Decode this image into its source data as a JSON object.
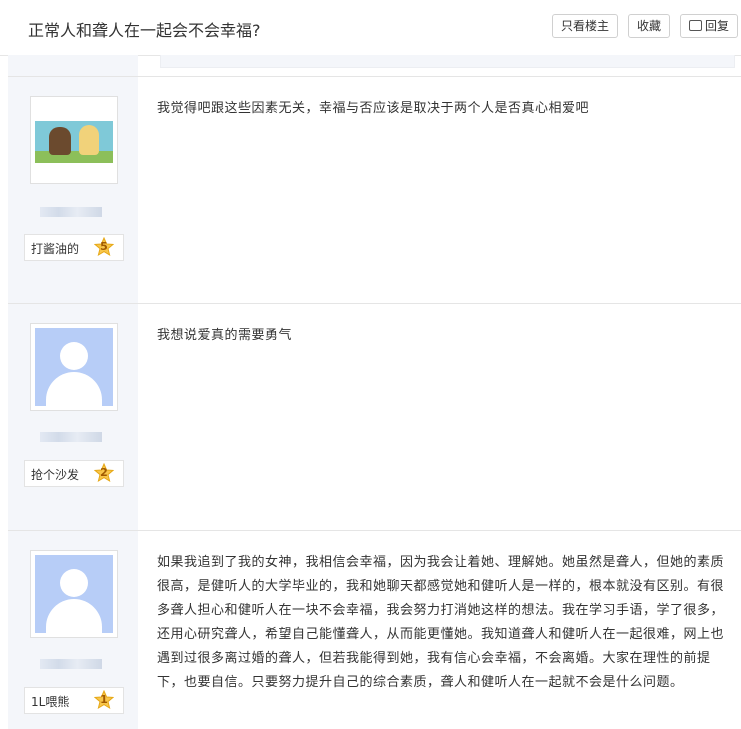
{
  "header": {
    "title": "正常人和聋人在一起会不会幸福?",
    "only_author": "只看楼主",
    "favorite": "收藏",
    "reply": "回复"
  },
  "posts": [
    {
      "badge": "打酱油的",
      "level": "5",
      "content": "我觉得吧跟这些因素无关，幸福与否应该是取决于两个人是否真心相爱吧"
    },
    {
      "badge": "抢个沙发",
      "level": "2",
      "content": "我想说爱真的需要勇气"
    },
    {
      "badge": "1L喂熊",
      "level": "1",
      "content": "如果我追到了我的女神，我相信会幸福，因为我会让着她、理解她。她虽然是聋人，但她的素质很高，是健听人的大学毕业的，我和她聊天都感觉她和健听人是一样的，根本就没有区别。有很多聋人担心和健听人在一块不会幸福，我会努力打消她这样的想法。我在学习手语，学了很多，还用心研究聋人，希望自己能懂聋人，从而能更懂她。我知道聋人和健听人在一起很难，网上也遇到过很多离过婚的聋人，但若我能得到她，我有信心会幸福，不会离婚。大家在理性的前提下，也要自信。只要努力提升自己的综合素质，聋人和健听人在一起就不会是什么问题。"
    }
  ]
}
